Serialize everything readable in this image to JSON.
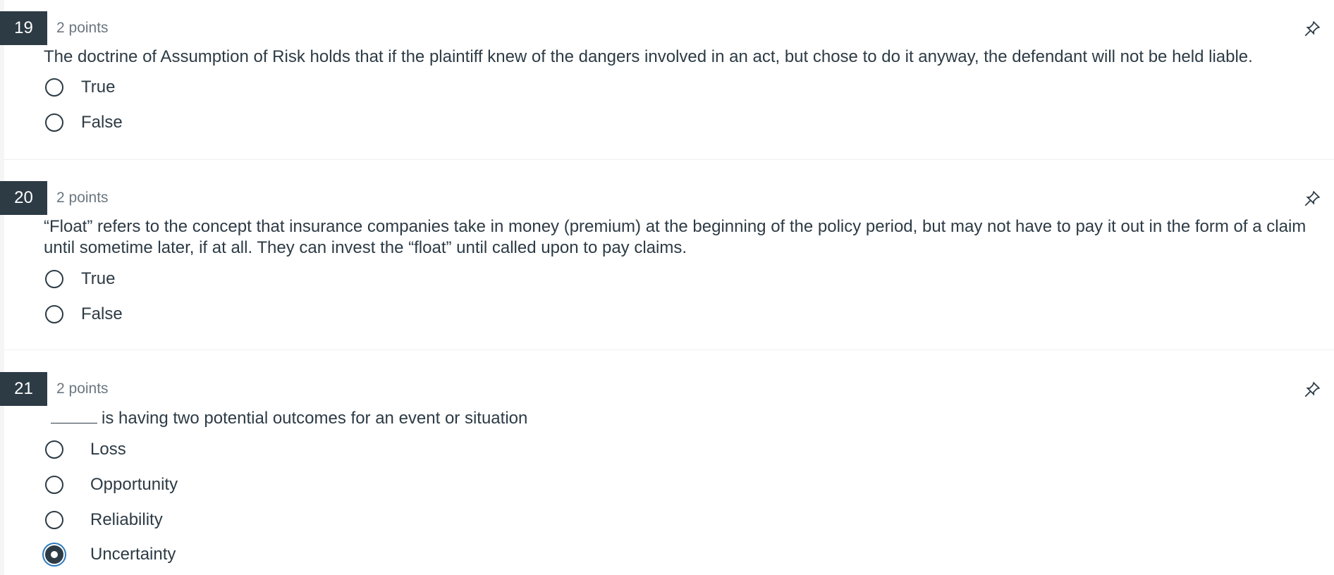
{
  "questions": [
    {
      "number": "19",
      "points": "2 points",
      "text": "The doctrine of Assumption of Risk holds that if the plaintiff knew of the dangers involved in an act, but chose to do it anyway, the defendant will not be held liable.",
      "options": [
        {
          "label": "True",
          "selected": false
        },
        {
          "label": "False",
          "selected": false
        }
      ]
    },
    {
      "number": "20",
      "points": "2 points",
      "text": "“Float” refers to the concept that insurance companies take in money (premium) at the beginning of the policy period, but may not have to pay it out in the form of a claim until sometime later, if at all.   They can invest the “float” until called upon to pay claims.",
      "options": [
        {
          "label": "True",
          "selected": false
        },
        {
          "label": "False",
          "selected": false
        }
      ]
    },
    {
      "number": "21",
      "points": "2 points",
      "text": "is having two potential outcomes for an event or situation",
      "options": [
        {
          "label": "Loss",
          "selected": false
        },
        {
          "label": "Opportunity",
          "selected": false
        },
        {
          "label": "Reliability",
          "selected": false
        },
        {
          "label": "Uncertainty",
          "selected": true
        }
      ]
    }
  ],
  "icons": {
    "pin": "pin-icon"
  },
  "colors": {
    "number_bg": "#2d3b45",
    "text": "#2d3b45",
    "points": "#6b7780",
    "focus_ring": "#2b7abc"
  }
}
